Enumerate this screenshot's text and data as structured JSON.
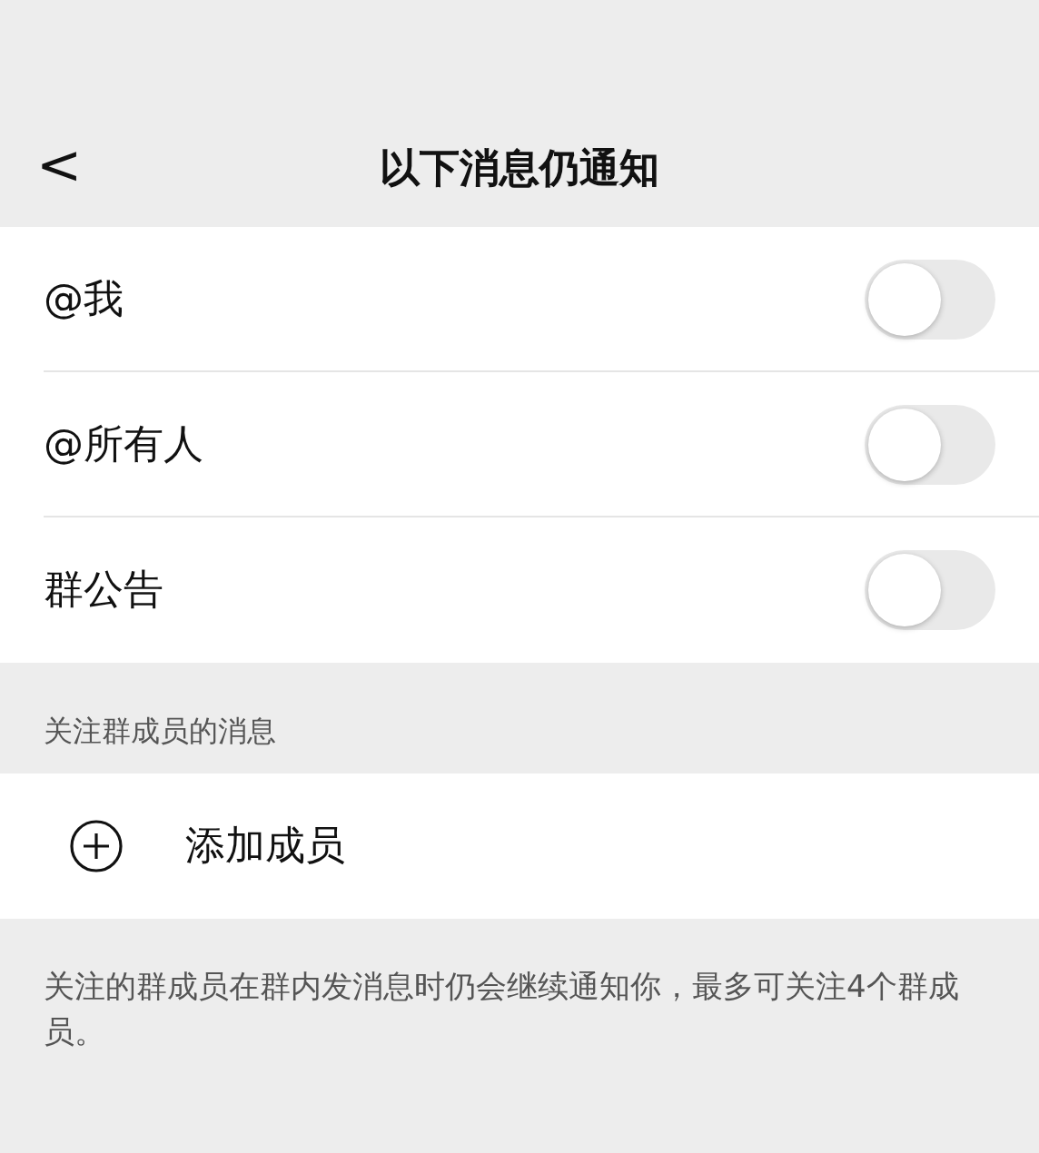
{
  "header": {
    "back": "<",
    "title": "以下消息仍通知"
  },
  "settings": [
    {
      "kind": "switch",
      "label": "@我",
      "on": false
    },
    {
      "kind": "switch",
      "label": "@所有人",
      "on": false
    },
    {
      "kind": "switch",
      "label": "群公告",
      "on": false
    }
  ],
  "members_section": {
    "title": "关注群成员的消息",
    "action": "添加成员"
  },
  "footnote": "关注的群成员在群内发消息时仍会继续通知你，最多可关注4个群成员。"
}
